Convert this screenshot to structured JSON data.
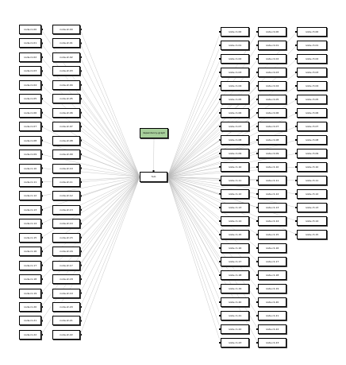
{
  "root": {
    "label": "dependency-graph"
  },
  "hub": {
    "label": "hub"
  },
  "left_col1": [
    "node-l1-00",
    "node-l1-01",
    "node-l1-02",
    "node-l1-03",
    "node-l1-04",
    "node-l1-05",
    "node-l1-06",
    "node-l1-07",
    "node-l1-08",
    "node-l1-09",
    "node-l1-10",
    "node-l1-11",
    "node-l1-12",
    "node-l1-13",
    "node-l1-14",
    "node-l1-15",
    "node-l1-16",
    "node-l1-17",
    "node-l1-18",
    "node-l1-19",
    "node-l1-20",
    "node-l1-21",
    "node-l1-22"
  ],
  "left_col2": [
    "node-l2-00",
    "node-l2-01",
    "node-l2-02",
    "node-l2-03",
    "node-l2-04",
    "node-l2-05",
    "node-l2-06",
    "node-l2-07",
    "node-l2-08",
    "node-l2-09",
    "node-l2-10",
    "node-l2-11",
    "node-l2-12",
    "node-l2-13",
    "node-l2-14",
    "node-l2-15",
    "node-l2-16",
    "node-l2-17",
    "node-l2-18",
    "node-l2-19",
    "node-l2-20",
    "node-l2-21",
    "node-l2-22"
  ],
  "right_col1": [
    "node-r1-00",
    "node-r1-01",
    "node-r1-02",
    "node-r1-03",
    "node-r1-04",
    "node-r1-05",
    "node-r1-06",
    "node-r1-07",
    "node-r1-08",
    "node-r1-09",
    "node-r1-10",
    "node-r1-11",
    "node-r1-12",
    "node-r1-13",
    "node-r1-14",
    "node-r1-15",
    "node-r1-16",
    "node-r1-17",
    "node-r1-18",
    "node-r1-19",
    "node-r1-20",
    "node-r1-21",
    "node-r1-22",
    "node-r1-23"
  ],
  "right_col2": [
    "node-r2-00",
    "node-r2-01",
    "node-r2-02",
    "node-r2-03",
    "node-r2-04",
    "node-r2-05",
    "node-r2-06",
    "node-r2-07",
    "node-r2-08",
    "node-r2-09",
    "node-r2-10",
    "node-r2-11",
    "node-r2-12",
    "node-r2-13",
    "node-r2-14",
    "node-r2-15",
    "node-r2-16",
    "node-r2-17",
    "node-r2-18",
    "node-r2-19",
    "node-r2-20",
    "node-r2-21",
    "node-r2-22",
    "node-r2-23"
  ],
  "right_col3": [
    "node-r3-00",
    "node-r3-01",
    "node-r3-02",
    "node-r3-03",
    "node-r3-04",
    "node-r3-05",
    "node-r3-06",
    "node-r3-07",
    "node-r3-08",
    "node-r3-09",
    "node-r3-10",
    "node-r3-11",
    "node-r3-12",
    "node-r3-13",
    "node-r3-14",
    "node-r3-15"
  ],
  "colors": {
    "root_fill": "#a7cf9b",
    "node_fill": "#ffffff",
    "edge": "#b9b9b9",
    "border": "#000000"
  }
}
